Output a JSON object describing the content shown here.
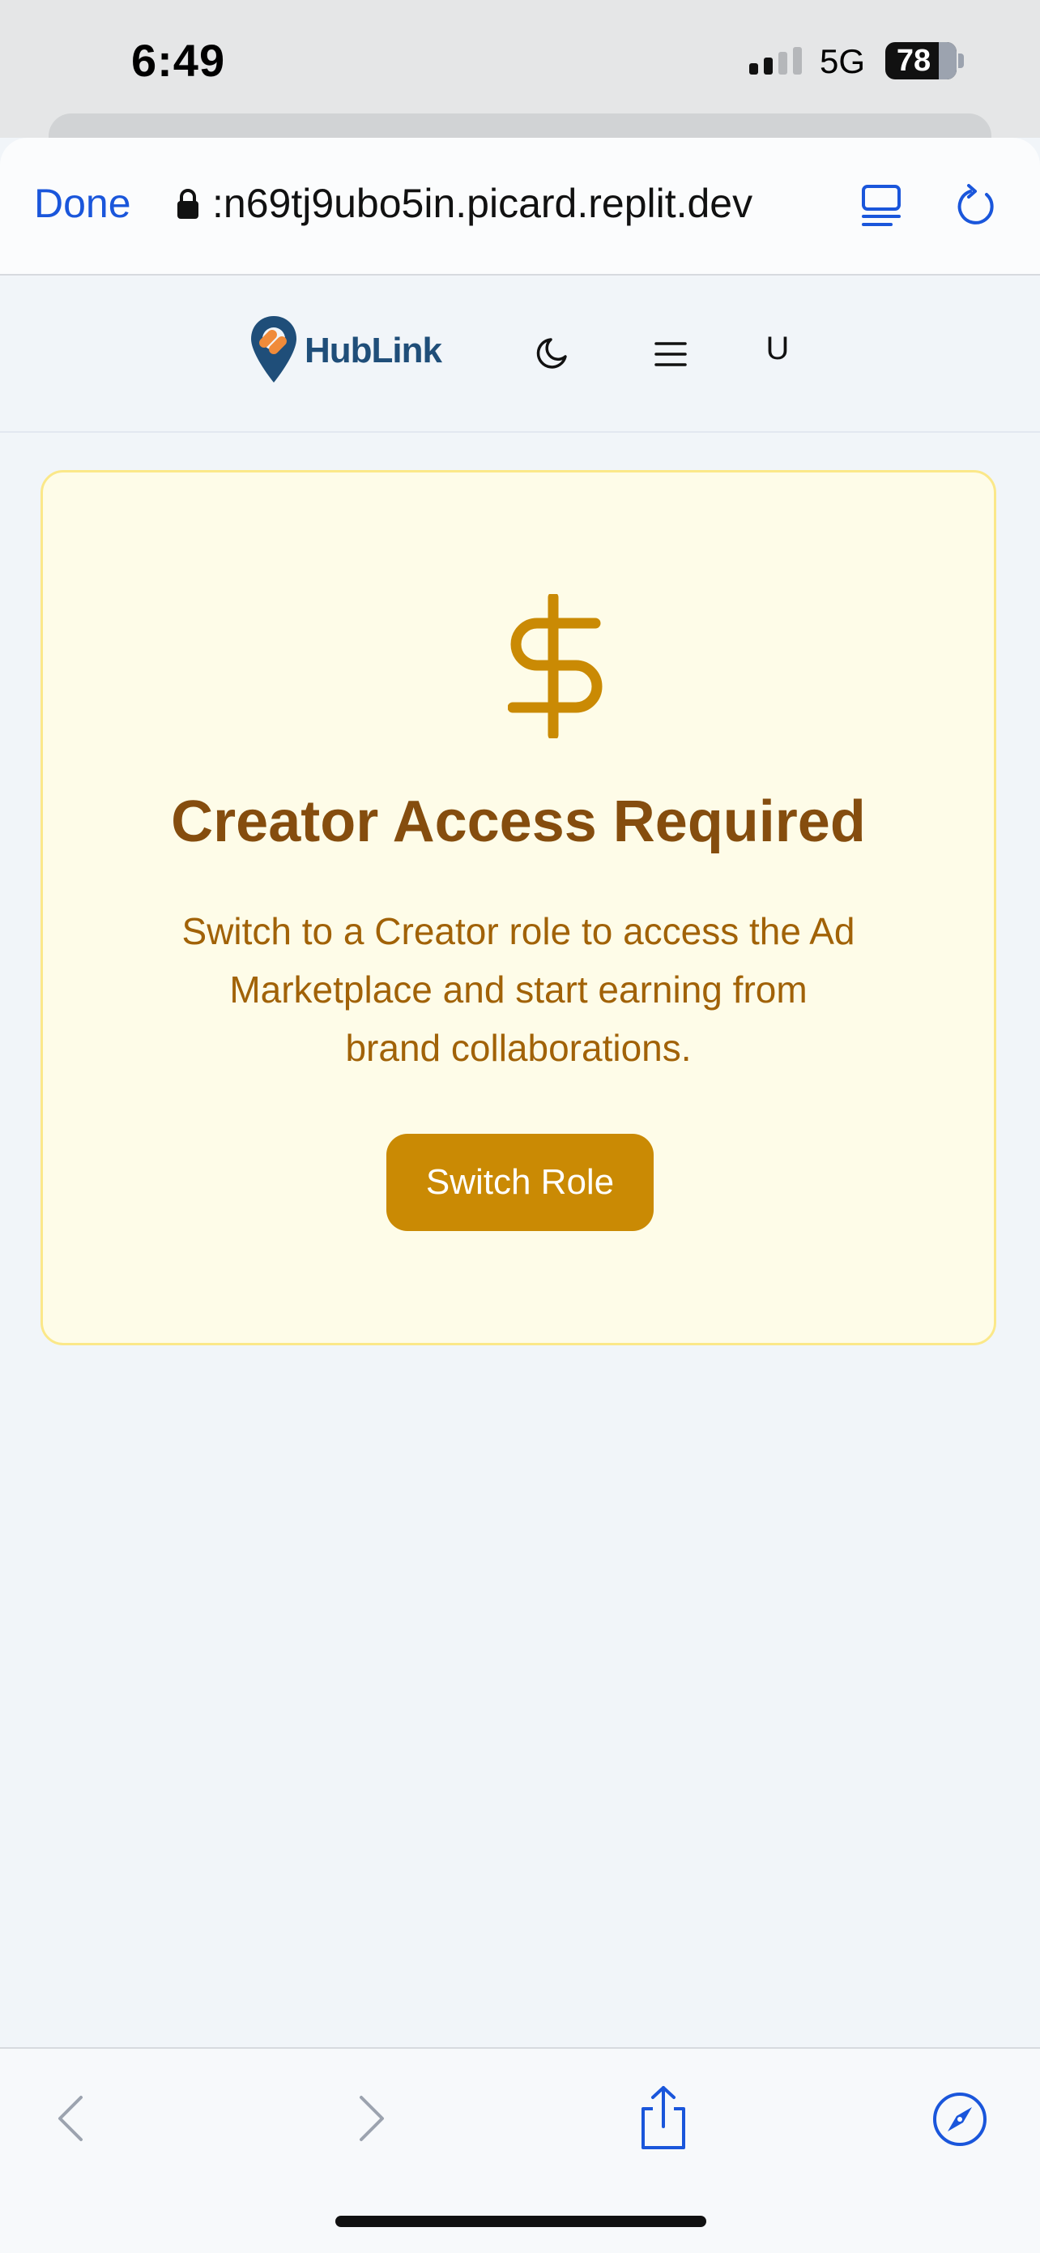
{
  "status_bar": {
    "time": "6:49",
    "network": "5G",
    "battery": "78"
  },
  "browser": {
    "done_label": "Done",
    "url": ":n69tj9ubo5in.picard.replit.dev",
    "accent_color": "#1a56db"
  },
  "app_header": {
    "logo_text": "HubLink",
    "user_initial": "U"
  },
  "card": {
    "icon": "dollar-icon",
    "title": "Creator Access Required",
    "message": "Switch to a Creator role to access the Ad Marketplace and start earning from brand collaborations.",
    "button_label": "Switch Role",
    "colors": {
      "background": "#fefce8",
      "border": "#fbe889",
      "title": "#854d0e",
      "text": "#a16207",
      "button": "#ca8a04"
    }
  },
  "toolbar_icons": [
    "back-icon",
    "forward-icon",
    "share-icon",
    "compass-icon"
  ]
}
